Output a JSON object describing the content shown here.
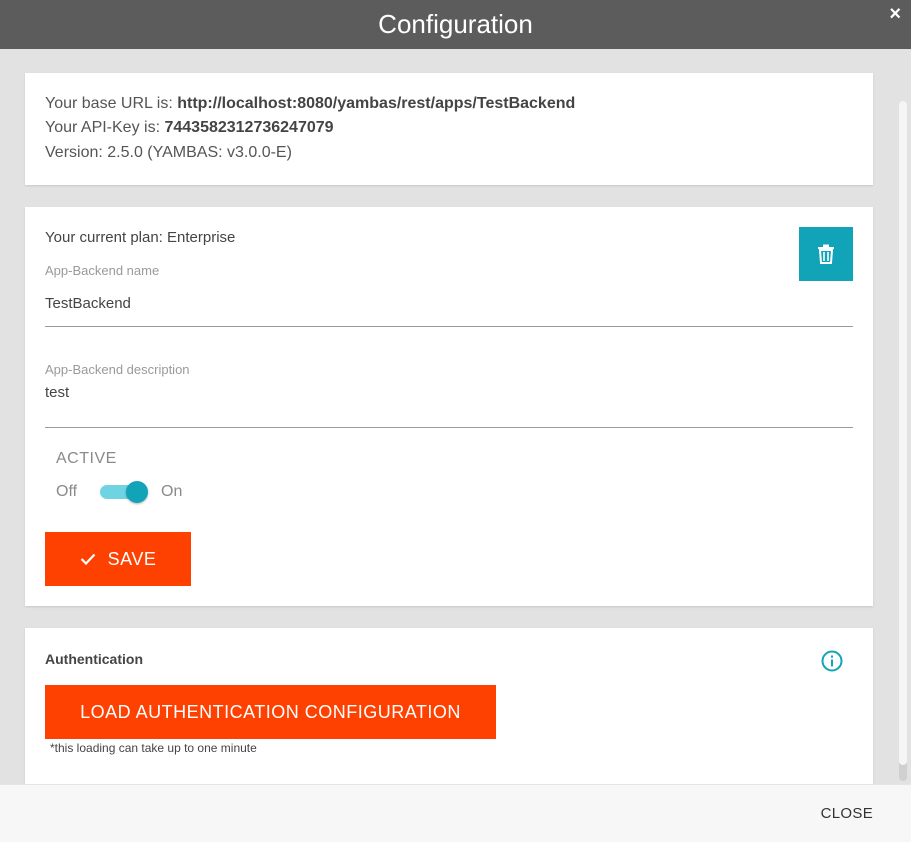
{
  "dialog": {
    "title": "Configuration",
    "close_symbol": "×"
  },
  "info": {
    "base_url_label": "Your base URL is: ",
    "base_url": "http://localhost:8080/yambas/rest/apps/TestBackend",
    "api_key_label": "Your API-Key is: ",
    "api_key": "7443582312736247079",
    "version": "Version: 2.5.0 (YAMBAS: v3.0.0-E)"
  },
  "settings": {
    "plan": "Your current plan: Enterprise",
    "name_label": "App-Backend name",
    "name_value": "TestBackend",
    "description_label": "App-Backend description",
    "description_value": "test",
    "active_label": "ACTIVE",
    "toggle_off": "Off",
    "toggle_on": "On",
    "active": true,
    "save_label": "SAVE"
  },
  "authentication": {
    "title": "Authentication",
    "load_label": "LOAD AUTHENTICATION CONFIGURATION",
    "note": "*this loading can take up to one minute"
  },
  "footer": {
    "close_label": "CLOSE"
  },
  "icons": {
    "delete": "trash-icon",
    "save": "check-icon",
    "info": "info-icon",
    "close": "close-icon"
  },
  "colors": {
    "accent": "#fe4100",
    "teal": "#11a3b8",
    "header": "#5c5c5c"
  }
}
